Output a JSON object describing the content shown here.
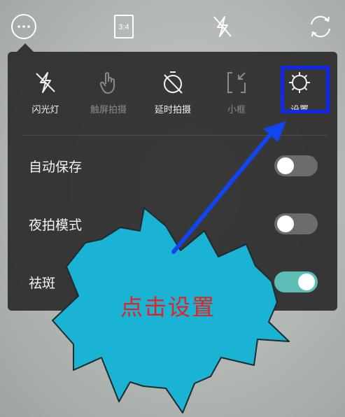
{
  "topbar": {
    "icons": [
      "more-icon",
      "aspect-ratio-icon",
      "flash-off-icon",
      "switch-camera-icon"
    ],
    "ratio_label": "3:4"
  },
  "menu": {
    "items": [
      {
        "label": "闪光灯",
        "icon": "flash-off-icon",
        "enabled": true
      },
      {
        "label": "触屏拍摄",
        "icon": "touch-icon",
        "enabled": false
      },
      {
        "label": "延时拍摄",
        "icon": "timer-off-icon",
        "enabled": true
      },
      {
        "label": "小框",
        "icon": "small-frame-icon",
        "enabled": false
      },
      {
        "label": "设置",
        "icon": "settings-gear-icon",
        "enabled": true
      }
    ],
    "toggles": [
      {
        "label": "自动保存",
        "on": false
      },
      {
        "label": "夜拍模式",
        "on": false
      },
      {
        "label": "祛斑",
        "on": true
      }
    ]
  },
  "annotation": {
    "callout_text": "点击设置",
    "highlight_color": "#1128ee",
    "arrow_color": "#1145f0",
    "callout_fill": "#1ab3d3",
    "text_color": "#e32222"
  },
  "colors": {
    "panel": "#282828",
    "toggle_on": "#5ebeb7",
    "toggle_off": "#6c6c6c"
  }
}
